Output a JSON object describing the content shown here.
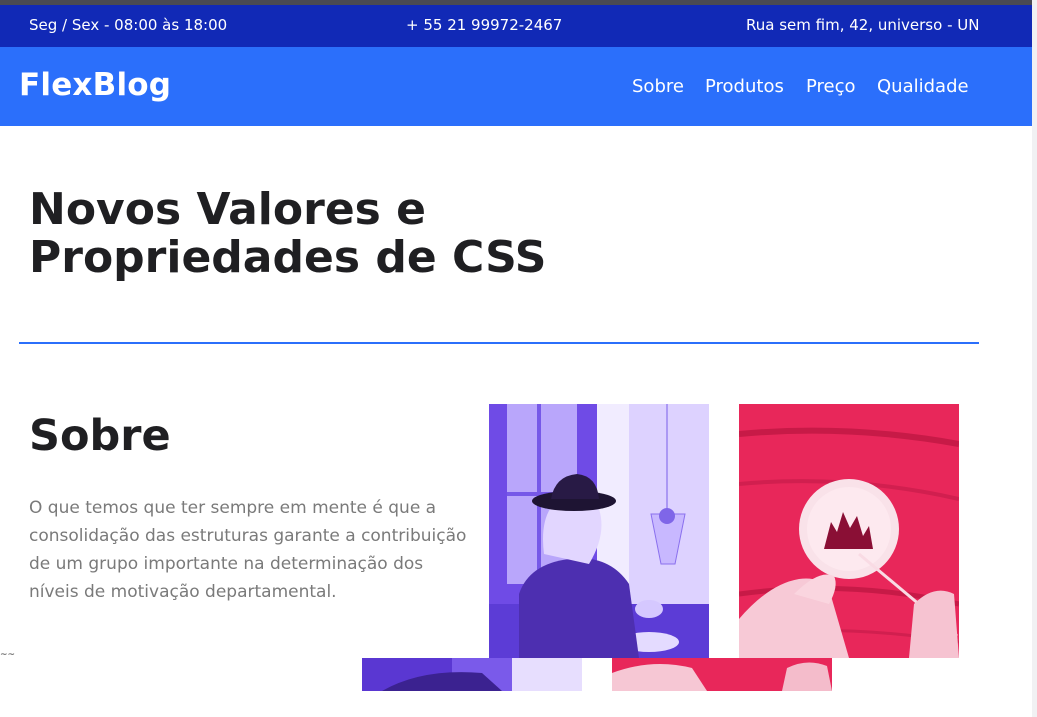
{
  "topbar": {
    "hours": "Seg / Sex - 08:00 às 18:00",
    "phone": "+ 55 21 99972-2467",
    "address": "Rua sem fim, 42, universo - UN"
  },
  "nav": {
    "logo": "FlexBlog",
    "items": [
      "Sobre",
      "Produtos",
      "Preço",
      "Qualidade"
    ]
  },
  "hero": {
    "title_line1": "Novos Valores e",
    "title_line2": "Propriedades de CSS"
  },
  "about": {
    "title": "Sobre",
    "text": "O que temos que ter sempre em mente é que a consolidação das estruturas garante a contribuição de um grupo importante na determinação dos níveis de motivação departamental."
  },
  "images": {
    "photo1": "woman-with-hat-purple-photo",
    "photo2": "hands-painting-plate-pink-photo"
  },
  "colors": {
    "topbar": "#1129b6",
    "navbar": "#2b6ffb",
    "accent": "#2b6ffb",
    "heading": "#1f1f22",
    "body_text": "#7a7a7a",
    "photo_purple": "#6f4be6",
    "photo_pink": "#e8275a"
  }
}
